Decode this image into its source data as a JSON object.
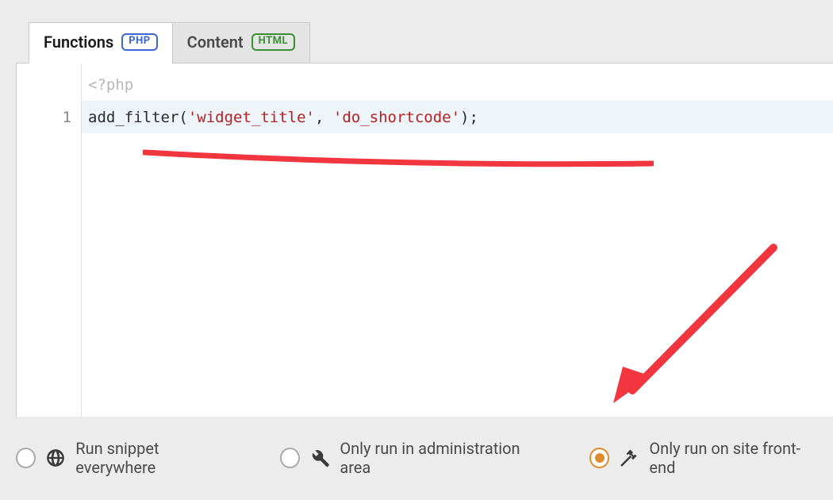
{
  "tabs": {
    "functions": {
      "label": "Functions",
      "badge": "PHP"
    },
    "content": {
      "label": "Content",
      "badge": "HTML"
    }
  },
  "editor": {
    "line0": "<?php",
    "line1": {
      "number": "1",
      "fn": "add_filter",
      "open": "(",
      "arg1": "'widget_title'",
      "comma": ", ",
      "arg2": "'do_shortcode'",
      "close": ");"
    }
  },
  "run_options": {
    "everywhere": "Run snippet everywhere",
    "admin": "Only run in administration area",
    "frontend": "Only run on site front-end",
    "selected": "frontend"
  },
  "annotations": {
    "color": "#f1363f"
  }
}
